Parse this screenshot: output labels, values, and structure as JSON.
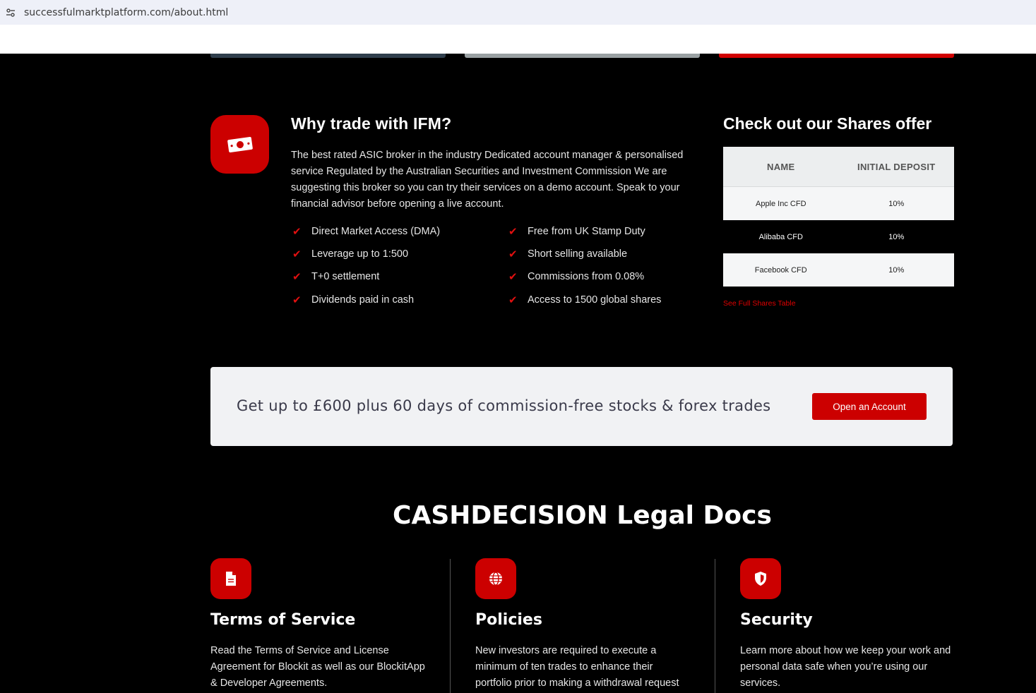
{
  "browser": {
    "url": "successfulmarktplatform.com/about.html",
    "site_info_icon": "tune-icon"
  },
  "why": {
    "icon": "banknote-icon",
    "title": "Why trade with IFM?",
    "description": "The best rated ASIC broker in the industry Dedicated account manager & personalised service Regulated by the Australian Securities and Investment Commission We are suggesting this broker so you can try their services on a demo account. Speak to your financial advisor before opening a live account.",
    "features_left": [
      "Direct Market Access (DMA)",
      "Leverage up to 1:500",
      "T+0 settlement",
      "Dividends paid in cash"
    ],
    "features_right": [
      "Free from UK Stamp Duty",
      "Short selling available",
      "Commissions from 0.08%",
      "Access to 1500 global shares"
    ],
    "check_icon": "checkmark-icon"
  },
  "shares": {
    "title": "Check out our Shares offer",
    "columns": [
      "NAME",
      "INITIAL DEPOSIT"
    ],
    "rows": [
      {
        "name": "Apple Inc CFD",
        "deposit": "10%"
      },
      {
        "name": "Alibaba CFD",
        "deposit": "10%"
      },
      {
        "name": "Facebook CFD",
        "deposit": "10%"
      }
    ],
    "link": "See Full Shares Table"
  },
  "promo": {
    "text": "Get up to £600 plus 60 days of commission-free stocks & forex trades",
    "button": "Open an Account"
  },
  "legal": {
    "title": "CASHDECISION Legal Docs",
    "docs": [
      {
        "icon": "document-icon",
        "title": "Terms of Service",
        "text": "Read the Terms of Service and License Agreement for Blockit as well as our BlockitApp & Developer Agreements."
      },
      {
        "icon": "globe-icon",
        "title": "Policies",
        "text": "New investors are required to execute a minimum of ten trades to enhance their portfolio prior to making a withdrawal request"
      },
      {
        "icon": "shield-icon",
        "title": "Security",
        "text": "Learn more about how we keep your work and personal data safe when you’re using our services."
      }
    ]
  },
  "colors": {
    "accent": "#cc0000",
    "background": "#000000",
    "promo_bg": "#f1f2f4"
  }
}
